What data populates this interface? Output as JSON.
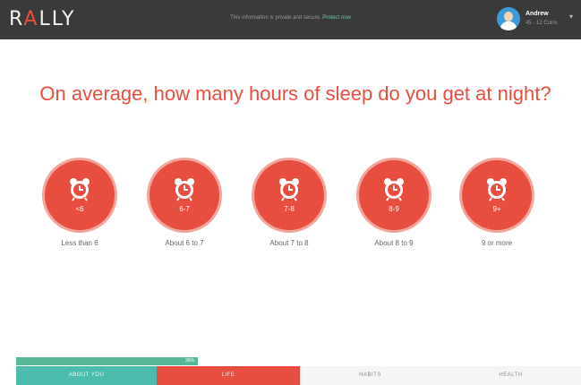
{
  "app": {
    "logo_prefix": "R",
    "logo_a": "A",
    "logo_suffix": "LLY"
  },
  "notice": {
    "text": "This information is private and secure.",
    "link": "Protect now"
  },
  "user": {
    "name": "Andrew",
    "subtitle": "45 · 12 Coins"
  },
  "question": "On average, how many hours of sleep do you get at night?",
  "options": [
    {
      "range": "<6",
      "label": "Less than 6"
    },
    {
      "range": "6-7",
      "label": "About 6 to 7"
    },
    {
      "range": "7-8",
      "label": "About 7 to 8"
    },
    {
      "range": "8-9",
      "label": "About 8 to 9"
    },
    {
      "range": "9+",
      "label": "9 or more"
    }
  ],
  "progress": {
    "value_percent": 36,
    "label": "36%"
  },
  "nav": {
    "tabs": [
      {
        "label": "ABOUT YOU",
        "state": "completed"
      },
      {
        "label": "LIFE",
        "state": "active"
      },
      {
        "label": "HABITS",
        "state": "upcoming"
      },
      {
        "label": "HEALTH",
        "state": "upcoming"
      }
    ]
  },
  "colors": {
    "accent": "#e84e3f",
    "teal": "#4cbcad",
    "green": "#58b895",
    "topbar": "#3a3a3a"
  },
  "icons": {
    "option_icon": "alarm-clock-icon",
    "menu_icon": "chevron-down-icon"
  }
}
